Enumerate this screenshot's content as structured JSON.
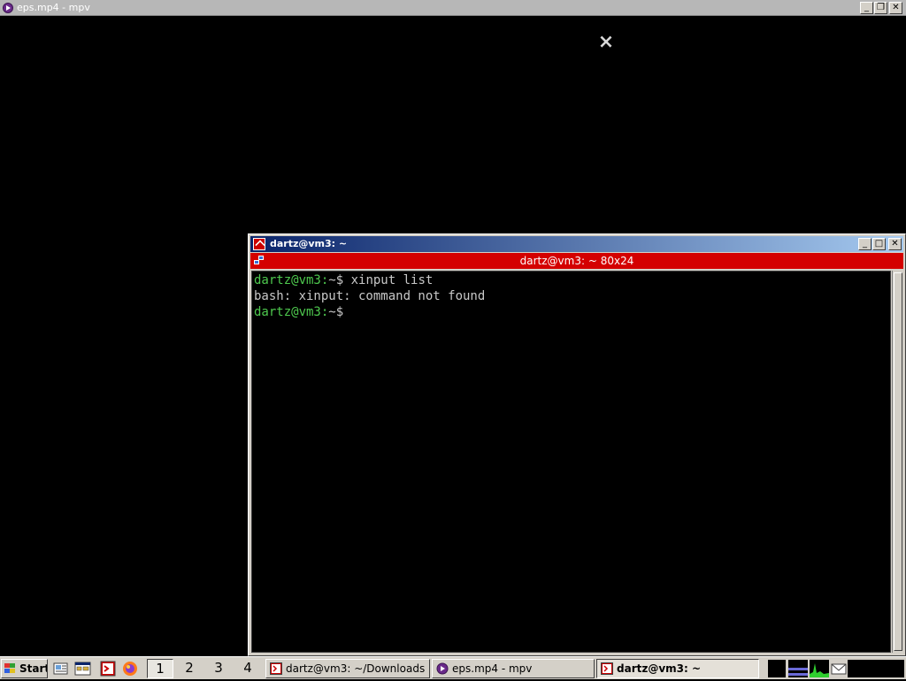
{
  "mpv": {
    "title": "eps.mp4 - mpv",
    "logo_glyph": "⨯"
  },
  "terminal": {
    "title": "dartz@vm3: ~",
    "header": "dartz@vm3: ~ 80x24",
    "lines": [
      {
        "prompt": "dartz@vm3:",
        "rest": "~$ xinput list"
      },
      {
        "prompt": "",
        "rest": "bash: xinput: command not found"
      },
      {
        "prompt": "dartz@vm3:",
        "rest": "~$"
      }
    ]
  },
  "window_buttons": {
    "minimize": "_",
    "maximize": "□",
    "restore": "❐",
    "close": "✕"
  },
  "taskbar": {
    "start_label": "Start",
    "workspaces": [
      "1",
      "2",
      "3",
      "4"
    ],
    "active_workspace": "1",
    "tasks": [
      {
        "label": "dartz@vm3: ~/Downloads",
        "icon": "terminal-icon"
      },
      {
        "label": "eps.mp4 - mpv",
        "icon": "mpv-icon"
      },
      {
        "label": "dartz@vm3: ~",
        "icon": "terminal-icon",
        "active": true
      }
    ],
    "tray_icons": [
      "monitor-icon",
      "cpu-graph-icon",
      "network-graph-icon",
      "mail-icon"
    ]
  },
  "colors": {
    "terminal_header": "#d40000",
    "prompt": "#4ec94e",
    "titlebar_active": "#0a246a"
  }
}
